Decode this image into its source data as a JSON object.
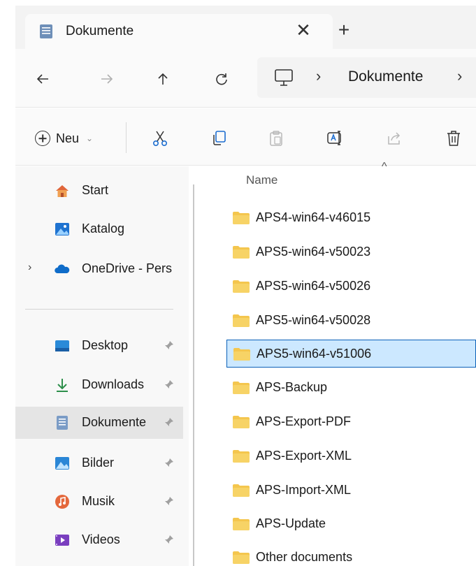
{
  "tab": {
    "title": "Dokumente",
    "close_glyph": "✕",
    "new_glyph": "+"
  },
  "navigation": {
    "back_icon": "arrow-left-icon",
    "forward_icon": "arrow-right-icon",
    "up_icon": "arrow-up-icon",
    "refresh_icon": "refresh-icon",
    "address": {
      "root_icon": "this-pc-icon",
      "separator": "›",
      "segment": "Dokumente"
    }
  },
  "commandbar": {
    "new_label": "Neu",
    "new_chevron": "⌄",
    "buttons": [
      "cut-icon",
      "copy-icon",
      "paste-icon",
      "rename-icon",
      "share-icon",
      "delete-icon"
    ]
  },
  "sidebar": {
    "items": [
      {
        "label": "Start",
        "icon": "home-icon",
        "pinned": false
      },
      {
        "label": "Katalog",
        "icon": "gallery-icon",
        "pinned": false
      },
      {
        "label": "OneDrive - Pers",
        "icon": "onedrive-icon",
        "pinned": false,
        "expandable": true
      },
      {
        "label": "Desktop",
        "icon": "desktop-icon",
        "pinned": true
      },
      {
        "label": "Downloads",
        "icon": "download-icon",
        "pinned": true
      },
      {
        "label": "Dokumente",
        "icon": "documents-icon",
        "pinned": true,
        "active": true
      },
      {
        "label": "Bilder",
        "icon": "pictures-icon",
        "pinned": true
      },
      {
        "label": "Musik",
        "icon": "music-icon",
        "pinned": true
      },
      {
        "label": "Videos",
        "icon": "videos-icon",
        "pinned": true
      }
    ],
    "expand_glyph": "›"
  },
  "filelist": {
    "sort_indicator": "^",
    "column_name": "Name",
    "items": [
      {
        "name": "APS4-win64-v46015",
        "selected": false
      },
      {
        "name": "APS5-win64-v50023",
        "selected": false
      },
      {
        "name": "APS5-win64-v50026",
        "selected": false
      },
      {
        "name": "APS5-win64-v50028",
        "selected": false
      },
      {
        "name": "APS5-win64-v51006",
        "selected": true
      },
      {
        "name": "APS-Backup",
        "selected": false
      },
      {
        "name": "APS-Export-PDF",
        "selected": false
      },
      {
        "name": "APS-Export-XML",
        "selected": false
      },
      {
        "name": "APS-Import-XML",
        "selected": false
      },
      {
        "name": "APS-Update",
        "selected": false
      },
      {
        "name": "Other documents",
        "selected": false
      }
    ]
  },
  "colors": {
    "selection_fill": "#cce8ff",
    "selection_border": "#0a60b8",
    "folder": "#f4c64e",
    "accent_blue": "#1c6dd0"
  }
}
